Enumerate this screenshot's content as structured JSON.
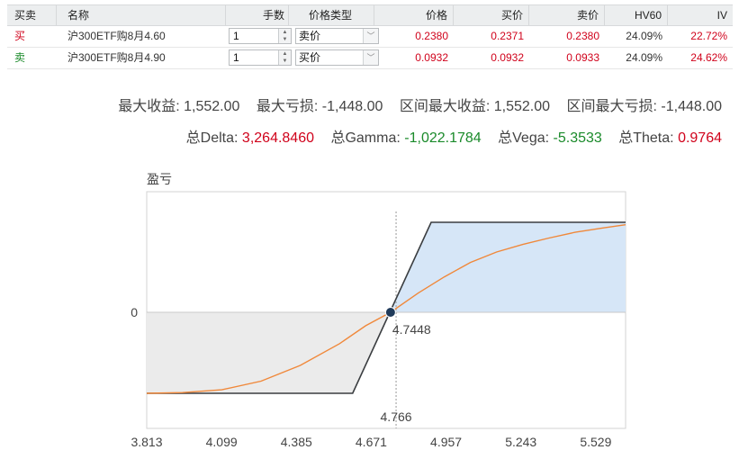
{
  "table": {
    "headers": {
      "side": "买卖",
      "name": "名称",
      "qty": "手数",
      "price_type": "价格类型",
      "price": "价格",
      "bid": "买价",
      "ask": "卖价",
      "hv60": "HV60",
      "iv": "IV"
    },
    "rows": [
      {
        "side": "买",
        "name": "沪300ETF购8月4.60",
        "qty": "1",
        "price_type": "卖价",
        "price": "0.2380",
        "bid": "0.2371",
        "ask": "0.2380",
        "hv60": "24.09%",
        "iv": "22.72%"
      },
      {
        "side": "卖",
        "name": "沪300ETF购8月4.90",
        "qty": "1",
        "price_type": "买价",
        "price": "0.0932",
        "bid": "0.0932",
        "ask": "0.0933",
        "hv60": "24.09%",
        "iv": "24.62%"
      }
    ]
  },
  "summary": {
    "max_profit_label": "最大收益:",
    "max_profit": "1,552.00",
    "max_loss_label": "最大亏损:",
    "max_loss": "-1,448.00",
    "range_max_profit_label": "区间最大收益:",
    "range_max_profit": "1,552.00",
    "range_max_loss_label": "区间最大亏损:",
    "range_max_loss": "-1,448.00",
    "delta_label": "总Delta:",
    "delta": "3,264.8460",
    "gamma_label": "总Gamma:",
    "gamma": "-1,022.1784",
    "vega_label": "总Vega:",
    "vega": "-5.3533",
    "theta_label": "总Theta:",
    "theta": "0.9764"
  },
  "colors": {
    "buy": "#d0021b",
    "sell": "#1a8a2a",
    "positive": "#d0021b",
    "negative": "#1a8a2a",
    "expiry_line": "#3a3d40",
    "current_line": "#f0883a",
    "profit_fill": "#d6e6f7",
    "loss_fill": "#ebebeb",
    "marker": "#1f3a5a"
  },
  "chart_data": {
    "type": "line",
    "ylabel": "盈亏",
    "x_ticks": [
      "3.813",
      "4.099",
      "4.385",
      "4.671",
      "4.957",
      "5.243",
      "5.529"
    ],
    "y_ticks": [
      {
        "value": 0,
        "label": "0"
      }
    ],
    "xlim": [
      3.813,
      5.643
    ],
    "ylim": [
      -1448,
      1552
    ],
    "breakeven": {
      "x": 4.7448,
      "label": "4.7448"
    },
    "current_price": {
      "x": 4.766,
      "label": "4.766"
    },
    "series": [
      {
        "role": "expiry",
        "x": [
          3.813,
          4.6,
          4.9,
          5.643
        ],
        "y": [
          -1448,
          -1448,
          1552,
          1552
        ]
      },
      {
        "role": "current",
        "x": [
          3.813,
          3.95,
          4.1,
          4.25,
          4.4,
          4.55,
          4.65,
          4.7448,
          4.85,
          4.95,
          5.05,
          5.15,
          5.25,
          5.35,
          5.45,
          5.55,
          5.643
        ],
        "y": [
          -1448,
          -1435,
          -1385,
          -1230,
          -950,
          -560,
          -240,
          0,
          330,
          610,
          860,
          1040,
          1170,
          1280,
          1380,
          1450,
          1510
        ]
      }
    ]
  }
}
